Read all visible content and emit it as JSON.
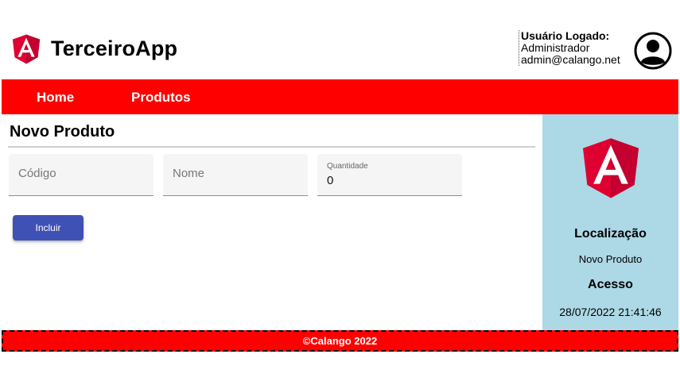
{
  "header": {
    "app_title": "TerceiroApp",
    "logo_icon": "angular-logo-icon",
    "user": {
      "heading": "Usuário Logado:",
      "name": "Administrador",
      "email": "admin@calango.net",
      "avatar_icon": "user-avatar-icon"
    }
  },
  "nav": {
    "items": [
      {
        "label": "Home"
      },
      {
        "label": "Produtos"
      }
    ]
  },
  "main": {
    "title": "Novo Produto",
    "form": {
      "codigo": {
        "placeholder": "Código",
        "value": ""
      },
      "nome": {
        "placeholder": "Nome",
        "value": ""
      },
      "quantidade": {
        "label": "Quantidade",
        "value": "0"
      }
    },
    "submit_label": "Incluir"
  },
  "side_panel": {
    "logo_icon": "angular-logo-icon",
    "location_heading": "Localização",
    "location_value": "Novo Produto",
    "access_heading": "Acesso",
    "access_value": "28/07/2022 21:41:46"
  },
  "footer": {
    "text": "©Calango 2022"
  },
  "colors": {
    "brand_red": "#ff0000",
    "angular_red": "#dd0031",
    "angular_dark_red": "#c3002f",
    "side_panel_bg": "#add8e6",
    "button_blue": "#3f51b5"
  }
}
